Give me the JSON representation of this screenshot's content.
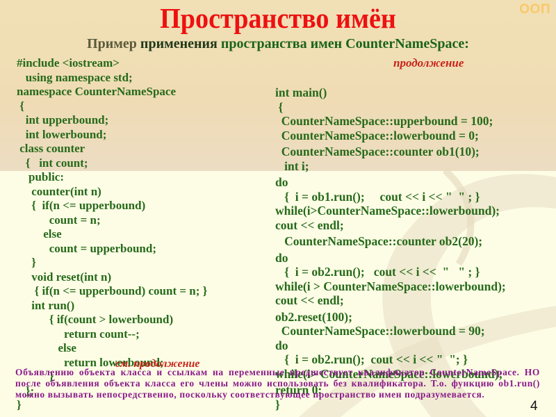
{
  "slide": {
    "section_label": "ООП",
    "title": "Пространство имён",
    "subtitle": {
      "part1": "Пример",
      "part2": "применения",
      "part3": "пространства имен CounterNameSpace:"
    },
    "page_number": "4"
  },
  "left_code": {
    "lines": [
      "#include <iostream>",
      "   using namespace std;",
      "namespace CounterNameSpace",
      " {",
      "   int upperbound;",
      "   int lowerbound;",
      " class counter",
      "   {   int count;",
      "    public:",
      "     counter(int n)",
      "     {  if(n <= upperbound)",
      "           count = n;",
      "         else",
      "           count = upperbound;",
      "     }",
      "     void reset(int n)",
      "      { if(n <= upperbound) count = n; }",
      "     int run()",
      "           { if(count > lowerbound)",
      "                return count--;",
      "              else",
      "                return lowerbound;",
      "           }",
      "   };",
      "}"
    ],
    "continuation_note": "см. продолжение"
  },
  "right_code": {
    "continuation_label": "продолжение",
    "lines": [
      "int main()",
      " {",
      "  CounterNameSpace::upperbound = 100;",
      "  CounterNameSpace::lowerbound = 0;",
      "  CounterNameSpace::counter ob1(10);",
      "   int i;",
      "do",
      "   {  i = ob1.run();     cout << i << \"  \" ; }",
      "while(i>CounterNameSpace::lowerbound);",
      "cout << endl;",
      "   CounterNameSpace::counter ob2(20);",
      "do",
      "   {  i = ob2.run();   cout << i <<  \"   \" ; }",
      "while(i > CounterNameSpace::lowerbound);",
      "cout << endl;",
      "ob2.reset(100);",
      "  CounterNameSpace::lowerbound = 90;",
      "do",
      "   {  i = ob2.run();  cout << i << \"  \"; }",
      "while(i> CounterNameSpace::lowerbound);",
      "return 0;",
      "}"
    ]
  },
  "note": {
    "text": "Объявлению объекта класса и ссылкам на переменные предшествует квалификатор CounterNameSpace. НО после объявления объекта класса его члены можно использовать без квалификатора. Т.о. функцию ob1.run() можно вызывать непосредственно, поскольку соответствующее пространство имен подразумевается."
  },
  "colors": {
    "title": "#ee1111",
    "code": "#266a1a",
    "continuation": "#c8241a",
    "note": "#8a1a8a",
    "section_label": "#f9c86a",
    "header_band": "#f1e0b5",
    "background": "#fdfde6"
  }
}
